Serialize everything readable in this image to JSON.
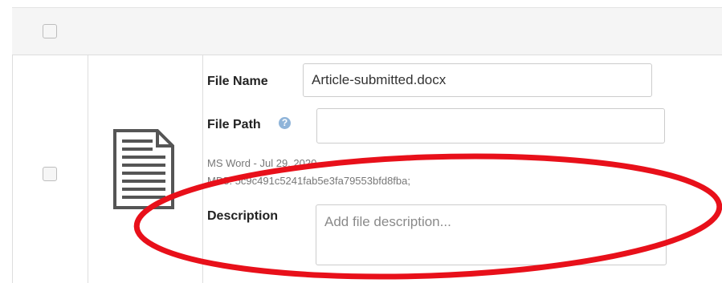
{
  "form": {
    "file_name_label": "File Name",
    "file_name_value": "Article-submitted.docx",
    "file_path_label": "File Path",
    "file_path_value": "",
    "help_glyph": "?",
    "meta_type_date": "MS Word - Jul 29, 2020",
    "meta_md5": "MD5: 5c9c491c5241fab5e3fa79553bfd8fba;",
    "description_label": "Description",
    "description_placeholder": "Add file description..."
  },
  "annotation": {
    "color": "#e8101a"
  }
}
